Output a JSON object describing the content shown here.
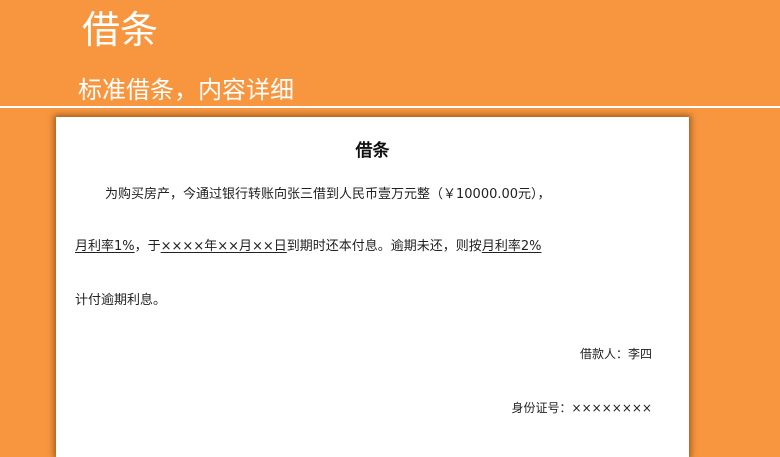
{
  "slide": {
    "title": "借条",
    "subtitle": "标准借条，内容详细"
  },
  "document": {
    "title": "借条",
    "line1": "为购买房产，今通过银行转账向张三借到人民币壹万元整（￥10000.00元），",
    "line2": {
      "rate_monthly": "月利率1%",
      "sep1": "，于",
      "due_date": "××××年××月××日",
      "text": "到期时还本付息。逾期未还，则按",
      "rate_overdue": "月利率2%"
    },
    "line3": "计付逾期利息。",
    "borrower": "借款人：李四",
    "id_number": "身份证号：××××××××"
  }
}
